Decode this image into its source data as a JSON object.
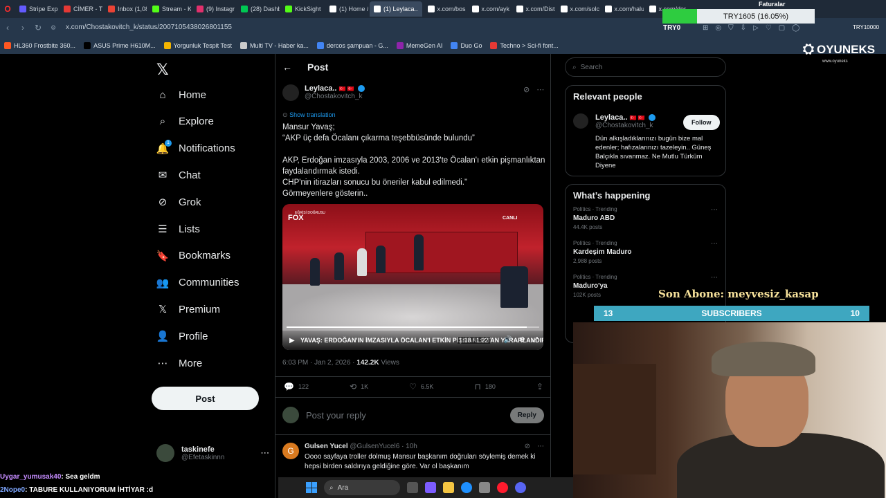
{
  "browser": {
    "tabs": [
      {
        "label": "Stripe Expr",
        "color": "#635bff"
      },
      {
        "label": "CİMER - T.C",
        "color": "#e53935"
      },
      {
        "label": "Inbox (1,08",
        "color": "#ea4335"
      },
      {
        "label": "Stream - Ki",
        "color": "#53fc18"
      },
      {
        "label": "(9) Instagr",
        "color": "#e1306c"
      },
      {
        "label": "(28) Dashb",
        "color": "#00c853"
      },
      {
        "label": "KickSight",
        "color": "#53fc18"
      },
      {
        "label": "(1) Home /",
        "color": "#ffffff"
      },
      {
        "label": "(1) Leylaca..",
        "color": "#ffffff"
      },
      {
        "label": "x.com/bos",
        "color": "#ffffff"
      },
      {
        "label": "x.com/ayk",
        "color": "#ffffff"
      },
      {
        "label": "x.com/Dist",
        "color": "#ffffff"
      },
      {
        "label": "x.com/solc",
        "color": "#ffffff"
      },
      {
        "label": "x.com/halu",
        "color": "#ffffff"
      },
      {
        "label": "x.com/der",
        "color": "#ffffff"
      }
    ],
    "url": "x.com/Chostakovitch_k/status/2007105438026801155",
    "bookmarks": [
      {
        "label": "HL360 Frostbite 360...",
        "color": "#ff5722"
      },
      {
        "label": "ASUS Prime H610M...",
        "color": "#000000"
      },
      {
        "label": "Yorgunluk Tespit Test",
        "color": "#f4b400"
      },
      {
        "label": "Multi TV - Haber ka...",
        "color": "#cccccc"
      },
      {
        "label": "dercos şampuan - G...",
        "color": "#4285f4"
      },
      {
        "label": "MemeGen AI",
        "color": "#8e24aa"
      },
      {
        "label": "Duo Go",
        "color": "#4285f4"
      },
      {
        "label": "Techno > Sci-fi font...",
        "color": "#e53935"
      }
    ]
  },
  "sidebar": {
    "items": [
      {
        "label": "Home",
        "icon": "home-icon",
        "glyph": "⌂"
      },
      {
        "label": "Explore",
        "icon": "search-icon",
        "glyph": "⌕"
      },
      {
        "label": "Notifications",
        "icon": "bell-icon",
        "glyph": "🔔"
      },
      {
        "label": "Chat",
        "icon": "mail-icon",
        "glyph": "✉"
      },
      {
        "label": "Grok",
        "icon": "grok-icon",
        "glyph": "⊘"
      },
      {
        "label": "Lists",
        "icon": "list-icon",
        "glyph": "☰"
      },
      {
        "label": "Bookmarks",
        "icon": "bookmark-icon",
        "glyph": "🔖"
      },
      {
        "label": "Communities",
        "icon": "people-icon",
        "glyph": "👥"
      },
      {
        "label": "Premium",
        "icon": "x-icon",
        "glyph": "𝕏"
      },
      {
        "label": "Profile",
        "icon": "person-icon",
        "glyph": "👤"
      },
      {
        "label": "More",
        "icon": "more-icon",
        "glyph": "⋯"
      }
    ],
    "notification_count": "1",
    "post_button": "Post",
    "account": {
      "name": "taskinefe",
      "handle": "@Efetaskinnn"
    }
  },
  "post": {
    "header": "Post",
    "author": {
      "name": "Leylaca..",
      "flags": "🇹🇷 🇹🇷",
      "handle": "@Chostakovitch_k"
    },
    "show_translation": "Show translation",
    "text": "Mansur Yavaş;\n“AKP üç defa Öcalanı çıkarma teşebbüsünde bulundu”\n\nAKP, Erdoğan imzasıyla 2003, 2006 ve 2013'te Öcalan'ı etkin pişmanlıktan faydalandırmak istedi.\nCHP'nin itirazları sonucu bu öneriler kabul edilmedi.”\nGörmeyenlere gösterin..",
    "video": {
      "channel": "FOX",
      "channel_sub": "EĞRİSİ DOĞRUSU",
      "live": "CANLI",
      "ticker": "YAVAŞ: ERDOĞAN'IN İMZASIYLA ÖCALAN'I ETKİN PİŞMANLIKTAN YARARLANDIRMAK İSTEDİLER",
      "time": "1:18 / 1:22",
      "progress": 0.95
    },
    "time": "6:03 PM · Jan 2, 2026",
    "views_count": "142.2K",
    "views_label": "Views",
    "actions": {
      "replies": "122",
      "reposts": "1K",
      "likes": "6.5K",
      "bookmarks": "180"
    },
    "reply_placeholder": "Post your reply",
    "reply_button": "Reply"
  },
  "reply": {
    "avatar_letter": "G",
    "name": "Gulsen Yucel",
    "handle": "@GulsenYucel6",
    "time": "· 10h",
    "text": "Oooo sayfaya troller dolmuş Mansur başkanım doğruları söylemiş demek ki hepsi birden saldırıya geldiğine göre. Var ol başkanım"
  },
  "right": {
    "search_placeholder": "Search",
    "relevant_title": "Relevant people",
    "person": {
      "name": "Leylaca..",
      "flags": "🇹🇷 🇹🇷",
      "handle": "@Chostakovitch_k",
      "follow": "Follow",
      "bio": "Dün alkışladıklarınızı bugün bize mal edenler; hafızalarınızı tazeleyin.. Güneş Balçıkla sıvanmaz. Ne Mutlu Türküm Diyene"
    },
    "happening_title": "What’s happening",
    "trends": [
      {
        "category": "Politics · Trending",
        "name": "Maduro ABD",
        "count": "44.4K posts"
      },
      {
        "category": "Politics · Trending",
        "name": "Kardeşim Maduro",
        "count": "2,988 posts"
      },
      {
        "category": "Politics · Trending",
        "name": "Maduro'ya",
        "count": "102K posts"
      }
    ]
  },
  "overlay": {
    "brand": "OYUNEKS",
    "brand_sub": "www.oyuneks",
    "try_value": "TRY1605 (16.05%)",
    "try_label": "TRY0",
    "try_right": "TRY10000",
    "faturalar": "Faturalar",
    "son_abone": "Son Abone: meyvesiz_kasap",
    "subs_left": "13",
    "subs_label": "SUBSCRIBERS",
    "subs_right": "10",
    "chat": [
      {
        "user": "Uygar_yumusak40",
        "msg": ": Sea geldm"
      },
      {
        "user": "2Nope0",
        "msg": ": TABURE KULLANIYORUM İHTİYAR :d"
      }
    ],
    "taskbar_search": "Ara"
  }
}
